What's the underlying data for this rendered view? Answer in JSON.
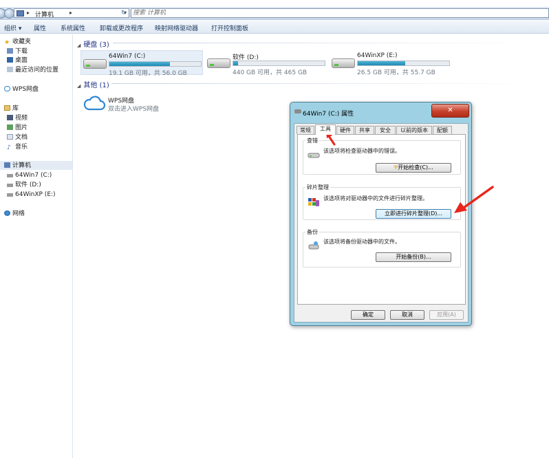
{
  "address_bar": {
    "path_label": "计算机",
    "search_placeholder": "搜索 计算机"
  },
  "toolbar": {
    "items": [
      "组织",
      "属性",
      "系统属性",
      "卸载或更改程序",
      "映射网络驱动器",
      "打开控制面板"
    ]
  },
  "nav": {
    "favorites": "收藏夹",
    "downloads": "下载",
    "desktop": "桌面",
    "recent": "最近访问的位置",
    "wps_cloud": "WPS网盘",
    "libraries": "库",
    "videos": "视频",
    "pictures": "图片",
    "documents": "文档",
    "music": "音乐",
    "computer": "计算机",
    "drive_c": "64Win7 (C:)",
    "drive_d": "软件 (D:)",
    "drive_e": "64WinXP (E:)",
    "network": "网络"
  },
  "content": {
    "hard_disks_header": "硬盘 (3)",
    "other_header": "其他 (1)",
    "drives": [
      {
        "name": "64Win7 (C:)",
        "free_text": "19.1 GB 可用，共 56.0 GB",
        "used_fraction": 0.66
      },
      {
        "name": "软件 (D:)",
        "free_text": "440 GB 可用，共 465 GB",
        "used_fraction": 0.05
      },
      {
        "name": "64WinXP (E:)",
        "free_text": "26.5 GB 可用，共 55.7 GB",
        "used_fraction": 0.52
      }
    ],
    "wps": {
      "name": "WPS网盘",
      "desc": "双击进入WPS网盘"
    }
  },
  "dialog": {
    "title": "64Win7 (C:) 属性",
    "close_label": "✕",
    "tabs": [
      "常规",
      "工具",
      "硬件",
      "共享",
      "安全",
      "以前的版本",
      "配额"
    ],
    "active_tab": "工具",
    "check": {
      "header": "查错",
      "text": "该选项将检查驱动器中的错误。",
      "button": "开始检查(C)..."
    },
    "defrag": {
      "header": "碎片整理",
      "text": "该选项将对驱动器中的文件进行碎片整理。",
      "button": "立即进行碎片整理(D)..."
    },
    "backup": {
      "header": "备份",
      "text": "该选项将备份驱动器中的文件。",
      "button": "开始备份(B)..."
    },
    "ok": "确定",
    "cancel": "取消",
    "apply": "应用(A)"
  },
  "colors": {
    "annotation_red": "#e8261b",
    "drive_bar": "#1f8ab3",
    "dialog_frame": "#9ed1e3",
    "close_red": "#c6412b"
  }
}
